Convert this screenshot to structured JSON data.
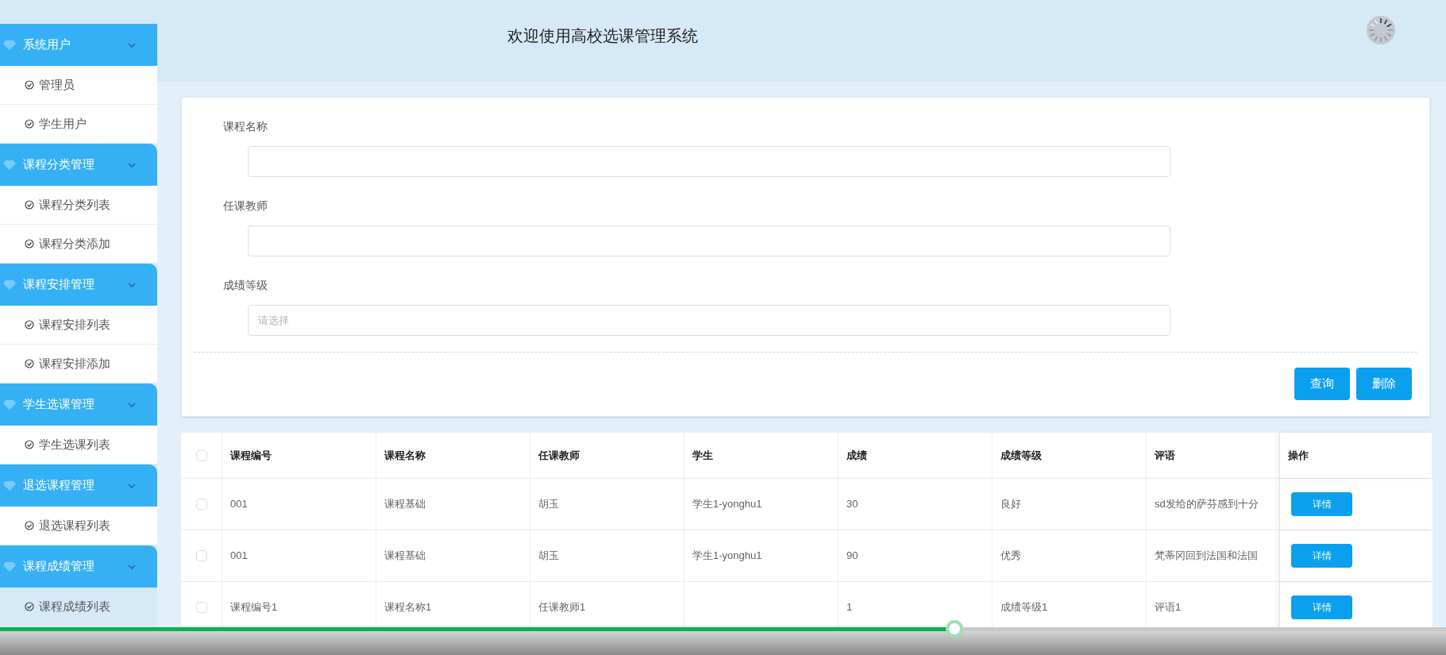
{
  "sidebar": {
    "groups": [
      {
        "title": "系统用户",
        "items": [
          {
            "label": "管理员",
            "selected": false
          },
          {
            "label": "学生用户",
            "selected": false
          }
        ]
      },
      {
        "title": "课程分类管理",
        "items": [
          {
            "label": "课程分类列表",
            "selected": false
          },
          {
            "label": "课程分类添加",
            "selected": false
          }
        ]
      },
      {
        "title": "课程安排管理",
        "items": [
          {
            "label": "课程安排列表",
            "selected": false
          },
          {
            "label": "课程安排添加",
            "selected": false
          }
        ]
      },
      {
        "title": "学生选课管理",
        "items": [
          {
            "label": "学生选课列表",
            "selected": false
          }
        ]
      },
      {
        "title": "退选课程管理",
        "items": [
          {
            "label": "退选课程列表",
            "selected": false
          }
        ]
      },
      {
        "title": "课程成绩管理",
        "items": [
          {
            "label": "课程成绩列表",
            "selected": true
          }
        ]
      }
    ]
  },
  "header": {
    "title": "欢迎使用高校选课管理系统"
  },
  "search_form": {
    "fields": [
      {
        "label": "课程名称",
        "kind": "text"
      },
      {
        "label": "任课教师",
        "kind": "text"
      },
      {
        "label": "成绩等级",
        "kind": "select",
        "placeholder": "请选择"
      }
    ],
    "buttons": [
      "查询",
      "删除"
    ]
  },
  "table": {
    "select_all": {
      "checked": false
    },
    "columns": [
      "课程编号",
      "课程名称",
      "任课教师",
      "学生",
      "成绩",
      "成绩等级",
      "评语",
      "操作"
    ],
    "rows": [
      {
        "checked": false,
        "cells": [
          "001",
          "课程基础",
          "胡玉",
          "学生1-yonghu1",
          "30",
          "良好",
          "sd发给的萨芬感到十分"
        ],
        "action": "详情"
      },
      {
        "checked": false,
        "cells": [
          "001",
          "课程基础",
          "胡玉",
          "学生1-yonghu1",
          "90",
          "优秀",
          "梵蒂冈回到法国和法国"
        ],
        "action": "详情"
      },
      {
        "checked": false,
        "cells": [
          "课程编号1",
          "课程名称1",
          "任课教师1",
          "",
          "1",
          "成绩等级1",
          "评语1"
        ],
        "action": "详情"
      }
    ]
  },
  "video_player": {
    "progress": {
      "level": 0.66
    }
  }
}
